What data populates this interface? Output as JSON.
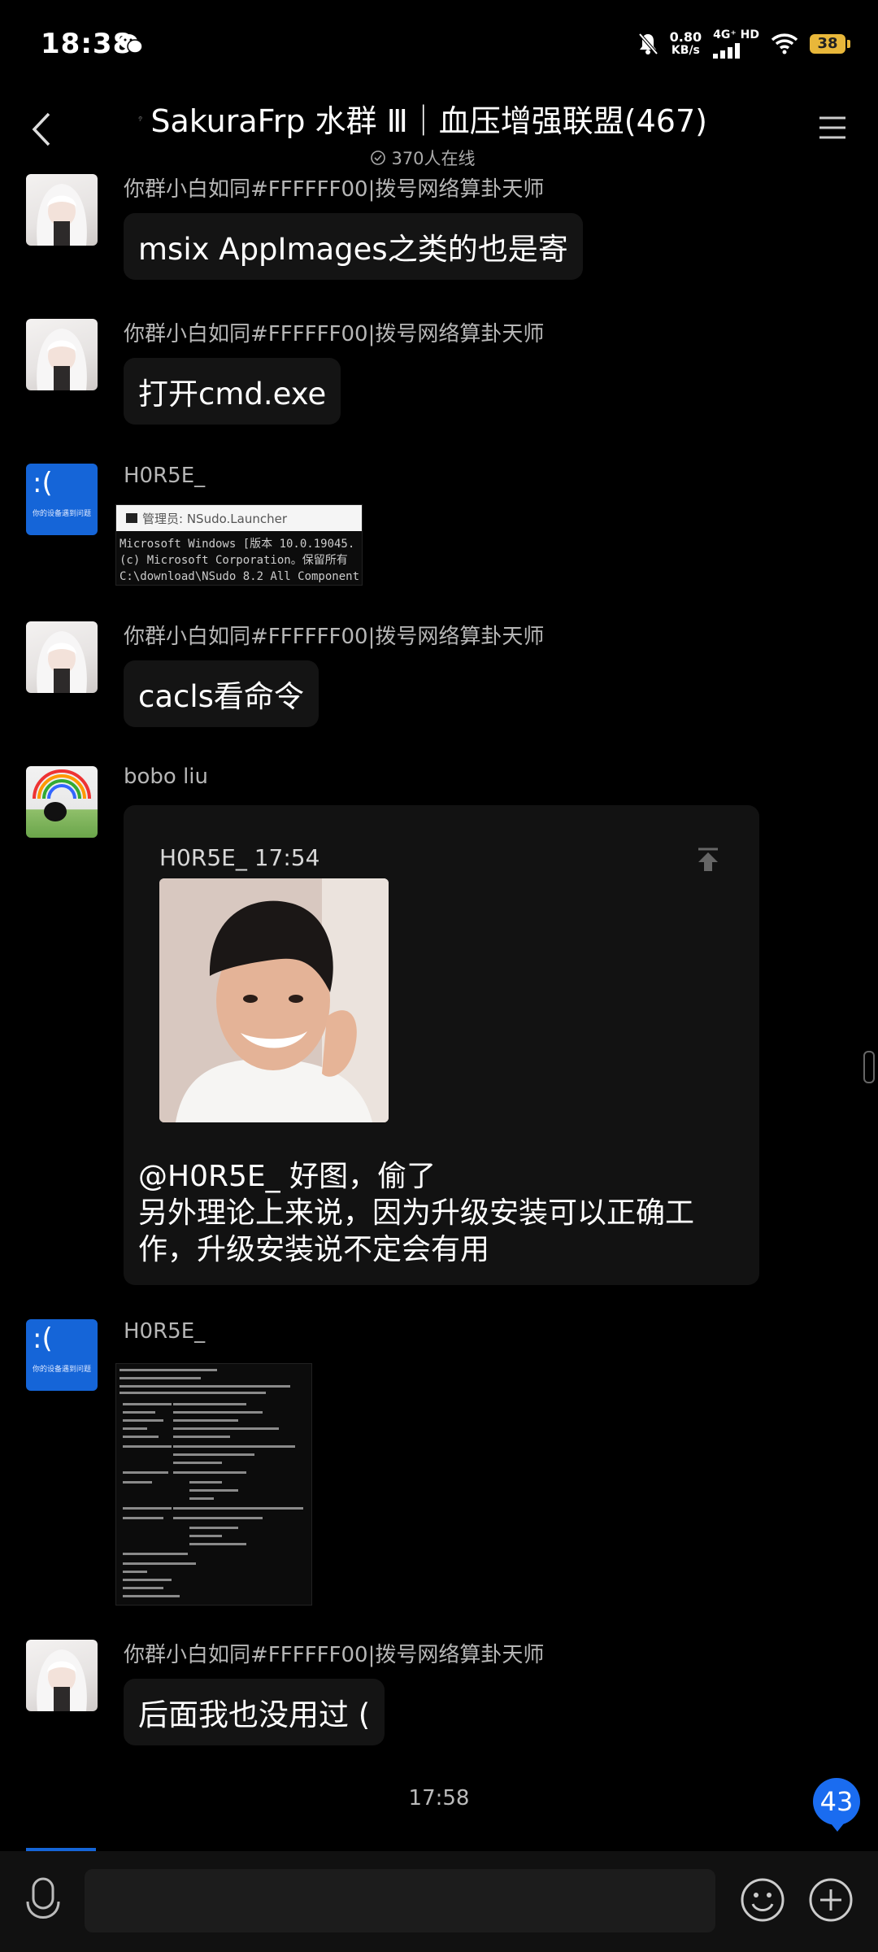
{
  "status_bar": {
    "time": "18:38",
    "net_speed": "0.80",
    "net_unit": "KB/s",
    "signal_label": "4G⁺ HD",
    "battery": "38"
  },
  "header": {
    "title": "SakuraFrp 水群 Ⅲ｜血压增强联盟(467)",
    "online": "370人在线"
  },
  "messages": [
    {
      "sender": "你群小白如同#FFFFFF00|拨号网络算卦天师",
      "text": "msix AppImages之类的也是寄"
    },
    {
      "sender": "你群小白如同#FFFFFF00|拨号网络算卦天师",
      "text": "打开cmd.exe"
    },
    {
      "sender": "H0R5E_",
      "shot_title": "管理员: NSudo.Launcher",
      "shot_lines": [
        "Microsoft Windows [版本 10.0.19045.",
        "(c) Microsoft Corporation。保留所有",
        "",
        "C:\\download\\NSudo 8.2 All Component"
      ]
    },
    {
      "sender": "你群小白如同#FFFFFF00|拨号网络算卦天师",
      "text": "cacls看命令"
    },
    {
      "sender": "bobo liu",
      "quote_head": "H0R5E_ 17:54",
      "reply_lines": [
        "@H0R5E_ 好图，偷了",
        "另外理论上来说，因为升级安装可以正确工",
        "作，升级安装说不定会有用"
      ]
    },
    {
      "sender": "H0R5E_"
    },
    {
      "sender": "你群小白如同#FFFFFF00|拨号网络算卦天师",
      "text": "后面我也没用过 ("
    }
  ],
  "avatar_blue_text": ":(",
  "avatar_blue_caption": "你的设备遇到问题",
  "time_separator": "17:58",
  "unread_badge": "43",
  "colors": {
    "accent": "#1a6cf0",
    "bluescreen": "#1565d8",
    "battery": "#e8b73a"
  }
}
